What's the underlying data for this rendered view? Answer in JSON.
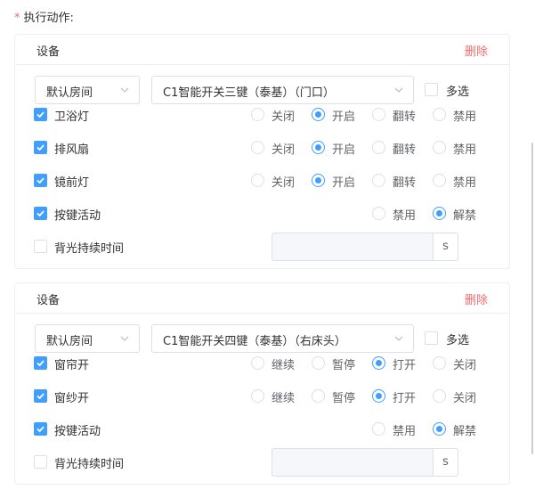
{
  "section": {
    "required_mark": "*",
    "label": "执行动作:"
  },
  "cards": [
    {
      "title": "设备",
      "delete_label": "删除",
      "room_select": "默认房间",
      "device_select": "C1智能开关三键（泰基）（门口）",
      "multi_label": "多选",
      "multi_checked": false,
      "rows": [
        {
          "label": "卫浴灯",
          "checked": true,
          "options": [
            "关闭",
            "开启",
            "翻转",
            "禁用"
          ],
          "selected": 1
        },
        {
          "label": "排风扇",
          "checked": true,
          "options": [
            "关闭",
            "开启",
            "翻转",
            "禁用"
          ],
          "selected": 1
        },
        {
          "label": "镜前灯",
          "checked": true,
          "options": [
            "关闭",
            "开启",
            "翻转",
            "禁用"
          ],
          "selected": 1
        },
        {
          "label": "按键活动",
          "checked": true,
          "options": [
            "禁用",
            "解禁"
          ],
          "selected": 1
        }
      ],
      "backlight_label": "背光持续时间",
      "backlight_checked": false,
      "backlight_value": "",
      "backlight_unit": "s"
    },
    {
      "title": "设备",
      "delete_label": "删除",
      "room_select": "默认房间",
      "device_select": "C1智能开关四键（泰基）（右床头）",
      "multi_label": "多选",
      "multi_checked": false,
      "rows": [
        {
          "label": "窗帘开",
          "checked": true,
          "options": [
            "继续",
            "暂停",
            "打开",
            "关闭"
          ],
          "selected": 2
        },
        {
          "label": "窗纱开",
          "checked": true,
          "options": [
            "继续",
            "暂停",
            "打开",
            "关闭"
          ],
          "selected": 2
        },
        {
          "label": "按键活动",
          "checked": true,
          "options": [
            "禁用",
            "解禁"
          ],
          "selected": 1
        }
      ],
      "backlight_label": "背光持续时间",
      "backlight_checked": false,
      "backlight_value": "",
      "backlight_unit": "s"
    }
  ],
  "colors": {
    "primary": "#409eff",
    "danger": "#f56c6c",
    "border": "#dcdfe6",
    "disabled_bg": "#f5f7fa"
  }
}
